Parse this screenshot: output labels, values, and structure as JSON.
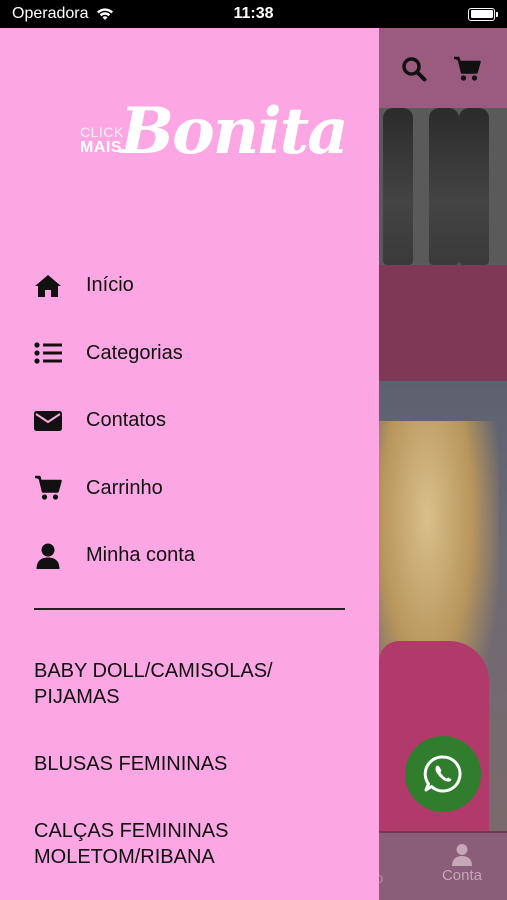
{
  "status_bar": {
    "carrier": "Operadora",
    "time": "11:38"
  },
  "logo": {
    "line1": "CLICK",
    "line2": "MAIS",
    "script": "Bonita"
  },
  "menu": [
    {
      "label": "Início",
      "icon": "home-icon"
    },
    {
      "label": "Categorias",
      "icon": "list-icon"
    },
    {
      "label": "Contatos",
      "icon": "envelope-icon"
    },
    {
      "label": "Carrinho",
      "icon": "cart-icon"
    },
    {
      "label": "Minha conta",
      "icon": "user-icon"
    }
  ],
  "categories": [
    "BABY DOLL/CAMISOLAS/\nPIJAMAS",
    "BLUSAS FEMININAS",
    "CALÇAS FEMININAS\nMOLETOM/RIBANA"
  ],
  "background": {
    "tab_account_label": "Conta",
    "tab_partial_label": "o"
  },
  "colors": {
    "drawer": "#fca7e4",
    "header_dimmed": "#9b5b7f",
    "whatsapp": "#2f7d2d"
  }
}
